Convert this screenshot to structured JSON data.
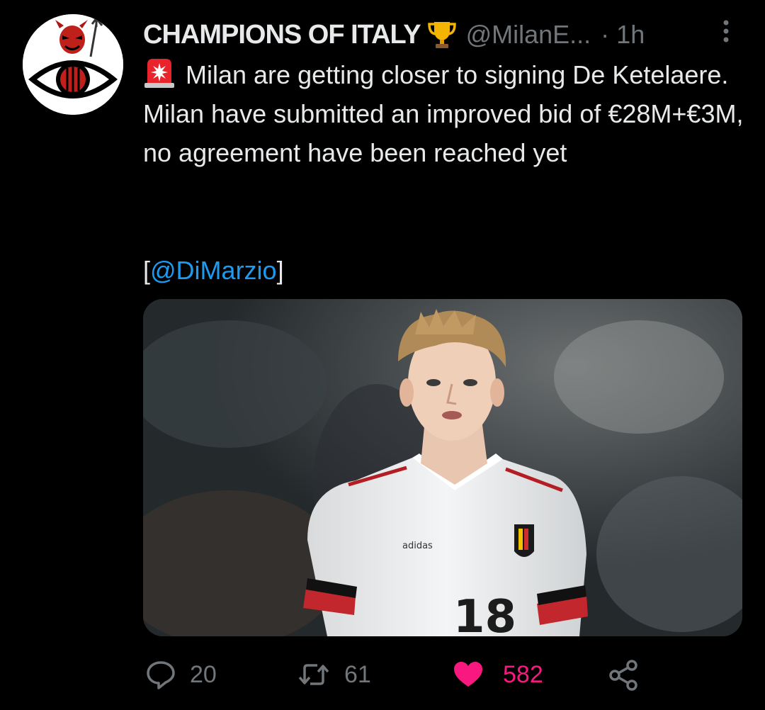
{
  "tweet": {
    "author": {
      "display_name": "CHAMPIONS OF ITALY",
      "badge_icon": "trophy-icon",
      "handle": "@MilanE...",
      "separator": "·",
      "time": "1h"
    },
    "text": {
      "leading_icon": "rotating-light-icon",
      "body": "Milan are getting closer to signing De Ketelaere. Milan have submitted an improved bid of €28M+€3M, no agreement have been reached yet",
      "mention_open": "[",
      "mention": "@DiMarzio",
      "mention_close": "]"
    },
    "media": {
      "kind": "photo",
      "shirt_number": "18",
      "shirt_brand": "adidas"
    },
    "actions": {
      "reply_count": "20",
      "retweet_count": "61",
      "like_count": "582",
      "liked": true
    }
  },
  "colors": {
    "background": "#000000",
    "text_primary": "#e7e9ea",
    "text_secondary": "#71767b",
    "link": "#1d9bf0",
    "like": "#f91880"
  }
}
